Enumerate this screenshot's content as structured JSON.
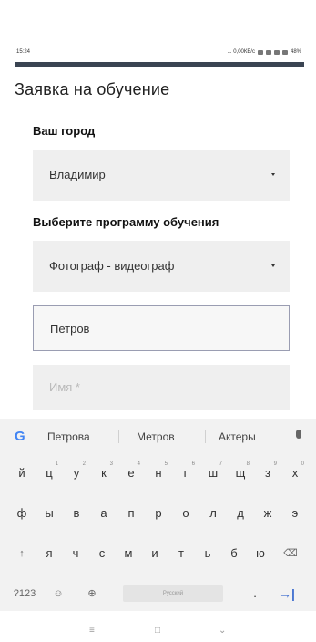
{
  "status_bar": {
    "time": "15:24",
    "indicators": "... 0,00КБ/с",
    "battery": "48%"
  },
  "page": {
    "title": "Заявка на обучение",
    "city": {
      "label": "Ваш город",
      "value": "Владимир"
    },
    "program": {
      "label": "Выберите программу обучения",
      "value": "Фотограф - видеограф"
    },
    "surname": {
      "value": "Петров"
    },
    "name": {
      "placeholder": "Имя *"
    }
  },
  "keyboard": {
    "suggestions": [
      "Петрова",
      "Метров",
      "Актеры"
    ],
    "row1": [
      {
        "k": "й",
        "s": ""
      },
      {
        "k": "ц",
        "s": "1"
      },
      {
        "k": "у",
        "s": "2"
      },
      {
        "k": "к",
        "s": "3"
      },
      {
        "k": "е",
        "s": "4"
      },
      {
        "k": "н",
        "s": "5"
      },
      {
        "k": "г",
        "s": "6"
      },
      {
        "k": "ш",
        "s": "7"
      },
      {
        "k": "щ",
        "s": "8"
      },
      {
        "k": "з",
        "s": "9"
      },
      {
        "k": "х",
        "s": "0"
      }
    ],
    "row2": [
      "ф",
      "ы",
      "в",
      "а",
      "п",
      "р",
      "о",
      "л",
      "д",
      "ж",
      "э"
    ],
    "row3": [
      "я",
      "ч",
      "с",
      "м",
      "и",
      "т",
      "ь",
      "б",
      "ю"
    ],
    "symbols_key": "?123",
    "space_label": "Русский",
    "period": "."
  },
  "icons": {
    "google": "google-g-icon",
    "mic": "mic-icon",
    "shift": "shift-icon",
    "backspace": "backspace-icon",
    "globe": "globe-icon",
    "enter": "enter-icon"
  }
}
